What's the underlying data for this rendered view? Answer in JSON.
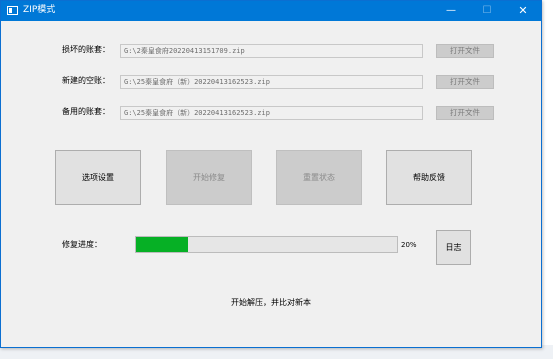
{
  "window": {
    "title": "ZIP模式",
    "minimize_glyph": "—",
    "maximize_glyph": "☐",
    "close_glyph": "✕"
  },
  "rows": [
    {
      "label": "损坏的账套：",
      "path": "G:\\2秦皇食府20220413151709.zip",
      "button": "打开文件"
    },
    {
      "label": "新建的空账：",
      "path": "G:\\25秦皇食府（新）20220413162523.zip",
      "button": "打开文件"
    },
    {
      "label": "备用的账套：",
      "path": "G:\\25秦皇食府（新）20220413162523.zip",
      "button": "打开文件"
    }
  ],
  "actions": {
    "options": "选项设置",
    "start": "开始修复",
    "reset": "重置状态",
    "help": "帮助反馈"
  },
  "progress": {
    "label": "修复进度：",
    "value": 0.2,
    "text": "20%",
    "color": "#06b025"
  },
  "log_button": "日志",
  "status": "开始解压，并比对新本",
  "colors": {
    "titlebar": "#0078d7",
    "window_bg": "#f0f0f0"
  }
}
